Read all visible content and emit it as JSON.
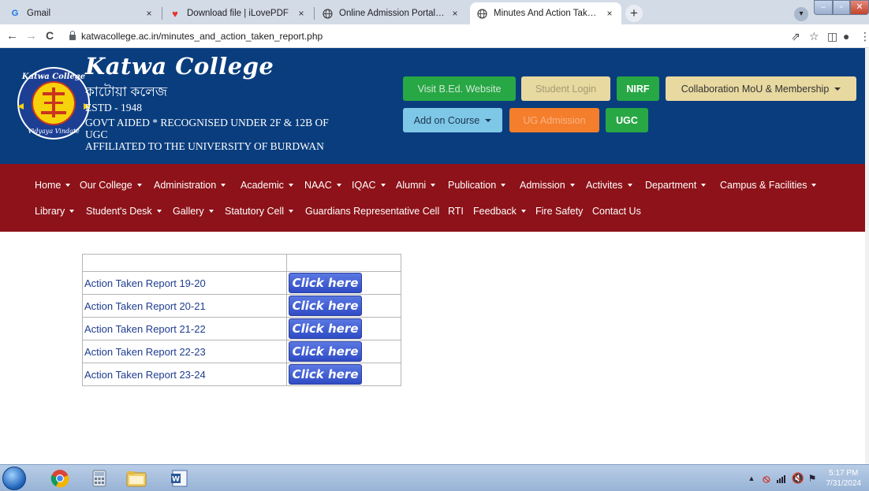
{
  "browser": {
    "tabs": [
      {
        "title": "Gmail",
        "favicon": "gmail-icon"
      },
      {
        "title": "Download file | iLovePDF",
        "favicon": "ilovepdf-heart-icon"
      },
      {
        "title": "Online Admission Portal | Katwa C",
        "favicon": "globe-icon"
      },
      {
        "title": "Minutes And Action Taken Repor",
        "favicon": "globe-icon",
        "active": true
      }
    ],
    "close_glyph": "×",
    "new_tab_glyph": "+",
    "url": "katwacollege.ac.in/minutes_and_action_taken_report.php",
    "nav": {
      "back": "←",
      "forward": "→",
      "reload": "C"
    }
  },
  "header": {
    "title": "Katwa College",
    "bengali_name": "কাটোয়া কলেজ",
    "estd": "ESTD - 1948",
    "govt_line1": "GOVT AIDED * RECOGNISED UNDER 2F & 12B OF",
    "govt_line2": "UGC",
    "affiliation": "AFFILIATED TO THE UNIVERSITY OF BURDWAN",
    "logo_text_top": "Katwa College",
    "logo_text_bottom": "Vidyaya Vindate",
    "buttons": {
      "bed": "Visit B.Ed. Website",
      "student_login": "Student Login",
      "nirf": "NIRF",
      "collab": "Collaboration MoU & Membership",
      "add_on": "Add on Course",
      "ug_admission": "UG Admission",
      "ugc": "UGC"
    },
    "colors": {
      "header_bg": "#093d7e",
      "nav_bg": "#8d1219",
      "green": "#28a745",
      "khaki": "#e8d9a0",
      "orange": "#f47e2b",
      "sky": "#7ec7e6"
    }
  },
  "nav": {
    "row1": [
      {
        "label": "Home",
        "dropdown": true
      },
      {
        "label": "Our College",
        "dropdown": true
      },
      {
        "label": "Administration",
        "dropdown": true
      },
      {
        "label": "Academic",
        "dropdown": true
      },
      {
        "label": "NAAC",
        "dropdown": true
      },
      {
        "label": "IQAC",
        "dropdown": true
      },
      {
        "label": "Alumni",
        "dropdown": true
      },
      {
        "label": "Publication",
        "dropdown": true
      },
      {
        "label": "Admission",
        "dropdown": true
      },
      {
        "label": "Activites",
        "dropdown": true
      },
      {
        "label": "Department",
        "dropdown": true
      },
      {
        "label": "Campus & Facilities",
        "dropdown": true
      }
    ],
    "row2": [
      {
        "label": "Library",
        "dropdown": true
      },
      {
        "label": "Student's Desk",
        "dropdown": true
      },
      {
        "label": "Gallery",
        "dropdown": true
      },
      {
        "label": "Statutory Cell",
        "dropdown": true
      },
      {
        "label": "Guardians Representative Cell",
        "dropdown": false
      },
      {
        "label": "RTI",
        "dropdown": false
      },
      {
        "label": "Feedback",
        "dropdown": true
      },
      {
        "label": "Fire Safety",
        "dropdown": false
      },
      {
        "label": "Contact Us",
        "dropdown": false
      }
    ]
  },
  "reports": {
    "rows": [
      {
        "label": "Action Taken Report 19-20",
        "button": "Click here"
      },
      {
        "label": "Action Taken Report 20-21",
        "button": "Click here"
      },
      {
        "label": "Action Taken Report 21-22",
        "button": "Click here"
      },
      {
        "label": "Action Taken Report 22-23",
        "button": "Click here"
      },
      {
        "label": "Action Taken Report 23-24",
        "button": "Click here"
      }
    ]
  },
  "taskbar": {
    "time": "5:17 PM",
    "date": "7/31/2024"
  }
}
